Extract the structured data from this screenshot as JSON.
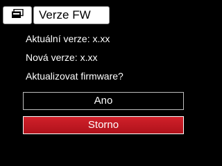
{
  "header": {
    "icon": "firmware-card-icon",
    "title": "Verze FW"
  },
  "info": {
    "current_version": "Aktuální verze: x.xx",
    "new_version": "Nová verze: x.xx",
    "prompt": "Aktualizovat firmware?"
  },
  "buttons": {
    "yes_label": "Ano",
    "cancel_label": "Storno"
  },
  "colors": {
    "background": "#000000",
    "selected_button": "#c41a24",
    "header_background": "#ffffff"
  }
}
